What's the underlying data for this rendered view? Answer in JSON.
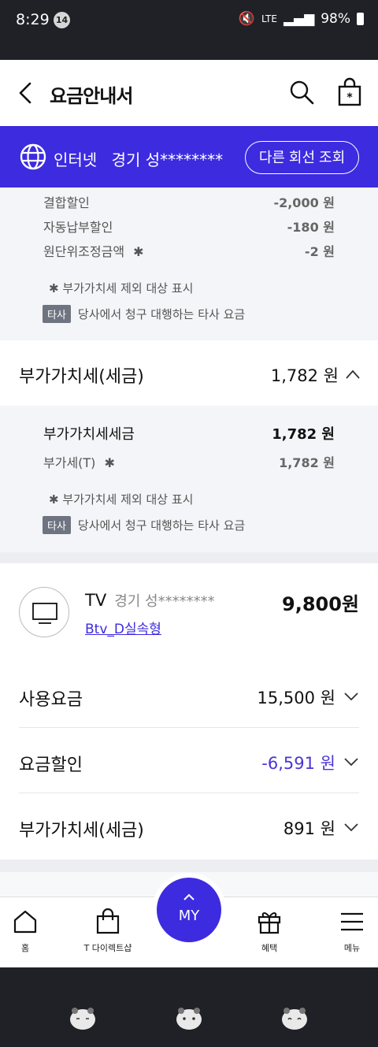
{
  "status_bar": {
    "time": "8:29",
    "badge": "14",
    "network": "LTE",
    "battery": "98%"
  },
  "header": {
    "title": "요금안내서"
  },
  "line_bar": {
    "service": "인터넷",
    "location": "경기 성********",
    "other_line_button": "다른 회선 조회"
  },
  "internet_details": {
    "rows": [
      {
        "label": "결합할인",
        "amount": "-2,000 원"
      },
      {
        "label": "자동납부할인",
        "amount": "-180 원"
      },
      {
        "label": "원단위조정금액",
        "mark": "✱",
        "amount": "-2 원"
      }
    ],
    "note_vat": "✱  부가가치세 제외 대상 표시",
    "tag": "타사",
    "note_other": "당사에서 청구 대행하는 타사 요금"
  },
  "vat_section": {
    "label": "부가가치세(세금)",
    "amount": "1,782 원"
  },
  "vat_details": {
    "rows": [
      {
        "label": "부가가치세세금",
        "amount": "1,782 원"
      },
      {
        "label": "부가세(T)",
        "mark": "✱",
        "amount": "1,782 원"
      }
    ],
    "note_vat": "✱  부가가치세 제외 대상 표시",
    "tag": "타사",
    "note_other": "당사에서 청구 대행하는 타사 요금"
  },
  "tv": {
    "title": "TV",
    "location": "경기 성********",
    "plan": "Btv_D실속형",
    "total": "9,800원",
    "rows": [
      {
        "label": "사용요금",
        "amount": "15,500 원"
      },
      {
        "label": "요금할인",
        "amount": "-6,591 원"
      },
      {
        "label": "부가가치세(세금)",
        "amount": "891 원"
      }
    ]
  },
  "bottom_nav": {
    "home": "홈",
    "shop": "T 다이렉트샵",
    "my": "MY",
    "benefits": "혜택",
    "menu": "메뉴"
  },
  "colors": {
    "brand": "#3d2be0",
    "discount": "#4a35d4"
  }
}
